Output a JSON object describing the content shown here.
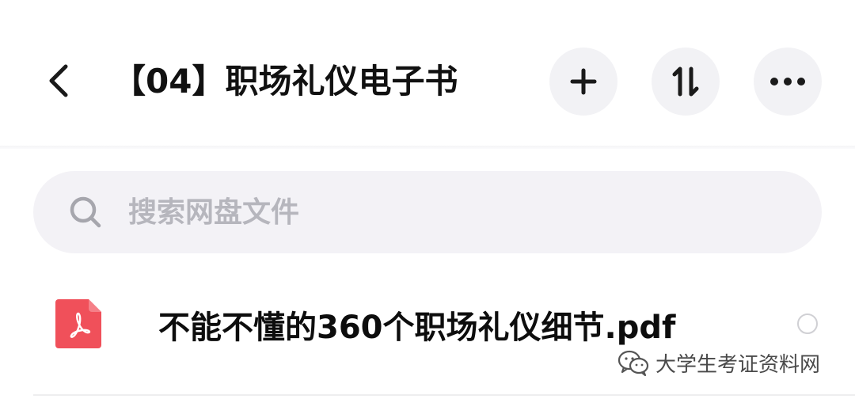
{
  "header": {
    "title": "【04】职场礼仪电子书",
    "back_icon": "chevron-left-icon",
    "actions": [
      {
        "name": "add",
        "icon": "plus-icon"
      },
      {
        "name": "sort",
        "icon": "sort-icon"
      },
      {
        "name": "more",
        "icon": "more-horizontal-icon"
      }
    ]
  },
  "search": {
    "placeholder": "搜索网盘文件",
    "value": "",
    "icon": "search-icon"
  },
  "files": [
    {
      "name": "不能不懂的360个职场礼仪细节.pdf",
      "icon": "pdf-icon",
      "selected": false
    }
  ],
  "watermark": {
    "text": "大学生考证资料网"
  },
  "colors": {
    "button_bg": "#f2f2f5",
    "search_bg": "#f3f2f6",
    "pdf_red": "#f0505a",
    "text": "#111111",
    "placeholder": "#b6b6bd"
  }
}
